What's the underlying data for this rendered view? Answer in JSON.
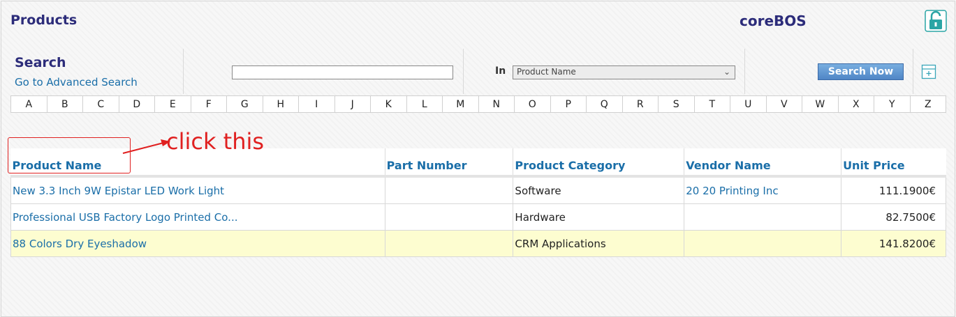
{
  "header": {
    "title": "Products",
    "brand": "coreBOS",
    "icons": {
      "lock": "unlock-icon"
    }
  },
  "search": {
    "title": "Search",
    "advanced_link": "Go to Advanced Search",
    "input_value": "",
    "in_label": "In",
    "in_selected": "Product Name",
    "button_label": "Search Now",
    "save_icon": "save-search-icon"
  },
  "alphabet": [
    "A",
    "B",
    "C",
    "D",
    "E",
    "F",
    "G",
    "H",
    "I",
    "J",
    "K",
    "L",
    "M",
    "N",
    "O",
    "P",
    "Q",
    "R",
    "S",
    "T",
    "U",
    "V",
    "W",
    "X",
    "Y",
    "Z"
  ],
  "annotation": {
    "text": "click this",
    "color": "#e02020"
  },
  "table": {
    "columns": [
      "Product Name",
      "Part Number",
      "Product Category",
      "Vendor Name",
      "Unit Price"
    ],
    "rows": [
      [
        "New 3.3 Inch 9W Epistar LED Work Light",
        "",
        "Software",
        "20 20 Printing Inc",
        "111.1900€"
      ],
      [
        "Professional USB Factory Logo Printed Co...",
        "",
        "Hardware",
        "",
        "82.7500€"
      ],
      [
        "88 Colors Dry Eyeshadow",
        "",
        "CRM Applications",
        "",
        "141.8200€"
      ]
    ]
  },
  "colors": {
    "title": "#2c2c7a",
    "link": "#1a6ea8",
    "highlight_row": "#fdfdd0",
    "button": "#4f86c6"
  }
}
